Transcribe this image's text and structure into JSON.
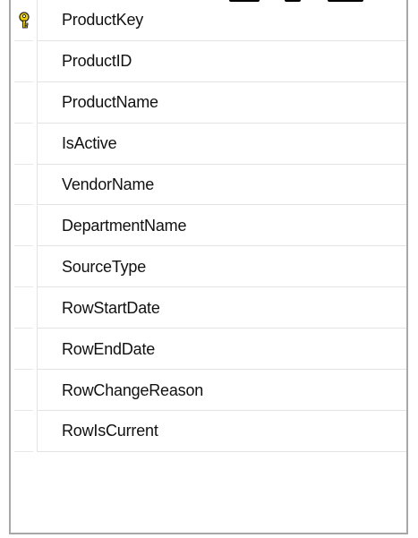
{
  "table_designer": {
    "rows": [
      {
        "name": "ProductKey",
        "primary_key": true,
        "icon": "key-icon"
      },
      {
        "name": "ProductID"
      },
      {
        "name": "ProductName"
      },
      {
        "name": "IsActive"
      },
      {
        "name": "VendorName"
      },
      {
        "name": "DepartmentName"
      },
      {
        "name": "SourceType"
      },
      {
        "name": "RowStartDate"
      },
      {
        "name": "RowEndDate"
      },
      {
        "name": "RowChangeReason"
      },
      {
        "name": "RowIsCurrent"
      }
    ]
  },
  "colors": {
    "key_icon": "#d9b800",
    "border": "#a7a7a7",
    "divider": "#e3e3e3"
  }
}
